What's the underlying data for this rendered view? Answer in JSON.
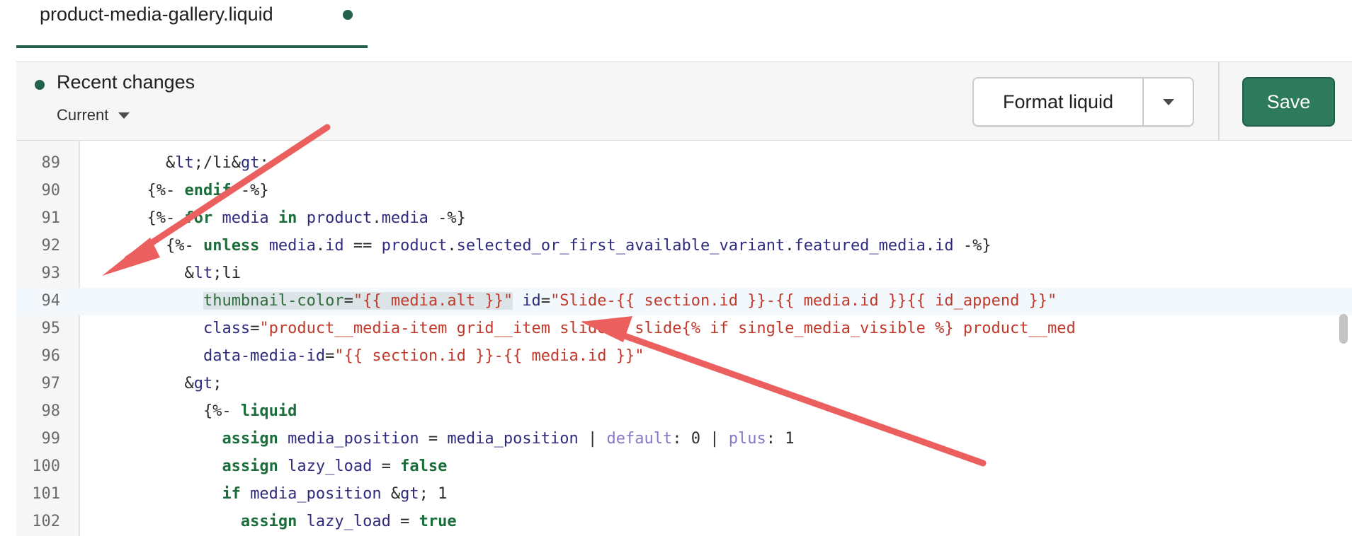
{
  "tab": {
    "filename": "product-media-gallery.liquid",
    "unsaved_indicator": "unsaved-dot"
  },
  "toolbar": {
    "status_title": "Recent changes",
    "version_label": "Current",
    "format_label": "Format liquid",
    "save_label": "Save"
  },
  "colors": {
    "accent": "#24604e",
    "save_bg": "#2e7a5c",
    "arrow": "#ec5f5f",
    "highlight": "#dde4e7"
  },
  "editor": {
    "active_line": 94,
    "lines": [
      {
        "num": "89",
        "text": "        </li>"
      },
      {
        "num": "90",
        "text": "      {%- endif -%}"
      },
      {
        "num": "91",
        "text": "      {%- for media in product.media -%}"
      },
      {
        "num": "92",
        "text": "        {%- unless media.id == product.selected_or_first_available_variant.featured_media.id -%}"
      },
      {
        "num": "93",
        "text": "          <li"
      },
      {
        "num": "94",
        "text": "            thumbnail-color=\"{{ media.alt }}\" id=\"Slide-{{ section.id }}-{{ media.id }}{{ id_append }}\""
      },
      {
        "num": "95",
        "text": "            class=\"product__media-item grid__item slider__slide{% if single_media_visible %} product__med"
      },
      {
        "num": "96",
        "text": "            data-media-id=\"{{ section.id }}-{{ media.id }}\""
      },
      {
        "num": "97",
        "text": "          >"
      },
      {
        "num": "98",
        "text": "            {%- liquid"
      },
      {
        "num": "99",
        "text": "              assign media_position = media_position | default: 0 | plus: 1"
      },
      {
        "num": "100",
        "text": "              assign lazy_load = false"
      },
      {
        "num": "101",
        "text": "              if media_position > 1"
      },
      {
        "num": "102",
        "text": "                assign lazy_load = true"
      }
    ]
  }
}
